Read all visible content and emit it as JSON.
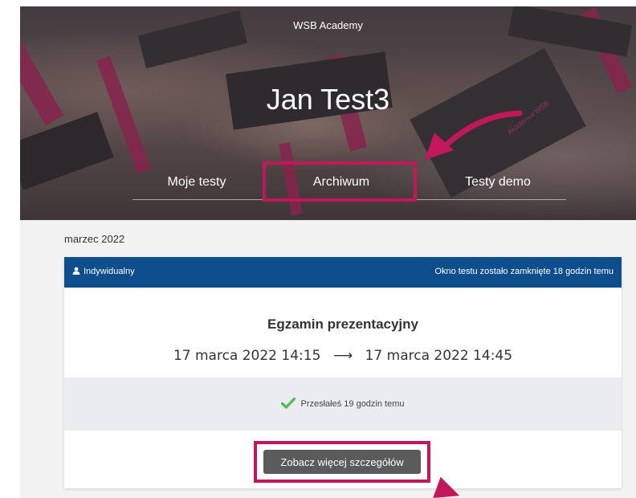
{
  "header": {
    "academy_label": "WSB Academy",
    "user_name": "Jan Test3",
    "cap_print": "Akademia WSB"
  },
  "tabs": [
    {
      "label": "Moje testy"
    },
    {
      "label": "Archiwum"
    },
    {
      "label": "Testy demo"
    }
  ],
  "section": {
    "month": "marzec 2022"
  },
  "card": {
    "type_label": "Indywidualny",
    "window_status": "Okno testu zostało zamknięte 18 godzin temu",
    "exam_title": "Egzamin prezentacyjny",
    "date_start": "17 marca 2022 14:15",
    "date_arrow": "⟶",
    "date_end": "17 marca 2022 14:45",
    "submission_status": "Przesłałeś 19 godzin temu",
    "details_button": "Zobacz więcej szczegółów"
  },
  "colors": {
    "accent_highlight": "#c2185b",
    "card_header": "#0e4e8c",
    "status_check": "#5cb85c",
    "button": "#5b5b5b"
  },
  "icons": {
    "user": "user-icon",
    "check": "check-icon",
    "arrow": "curved-arrow-icon"
  }
}
